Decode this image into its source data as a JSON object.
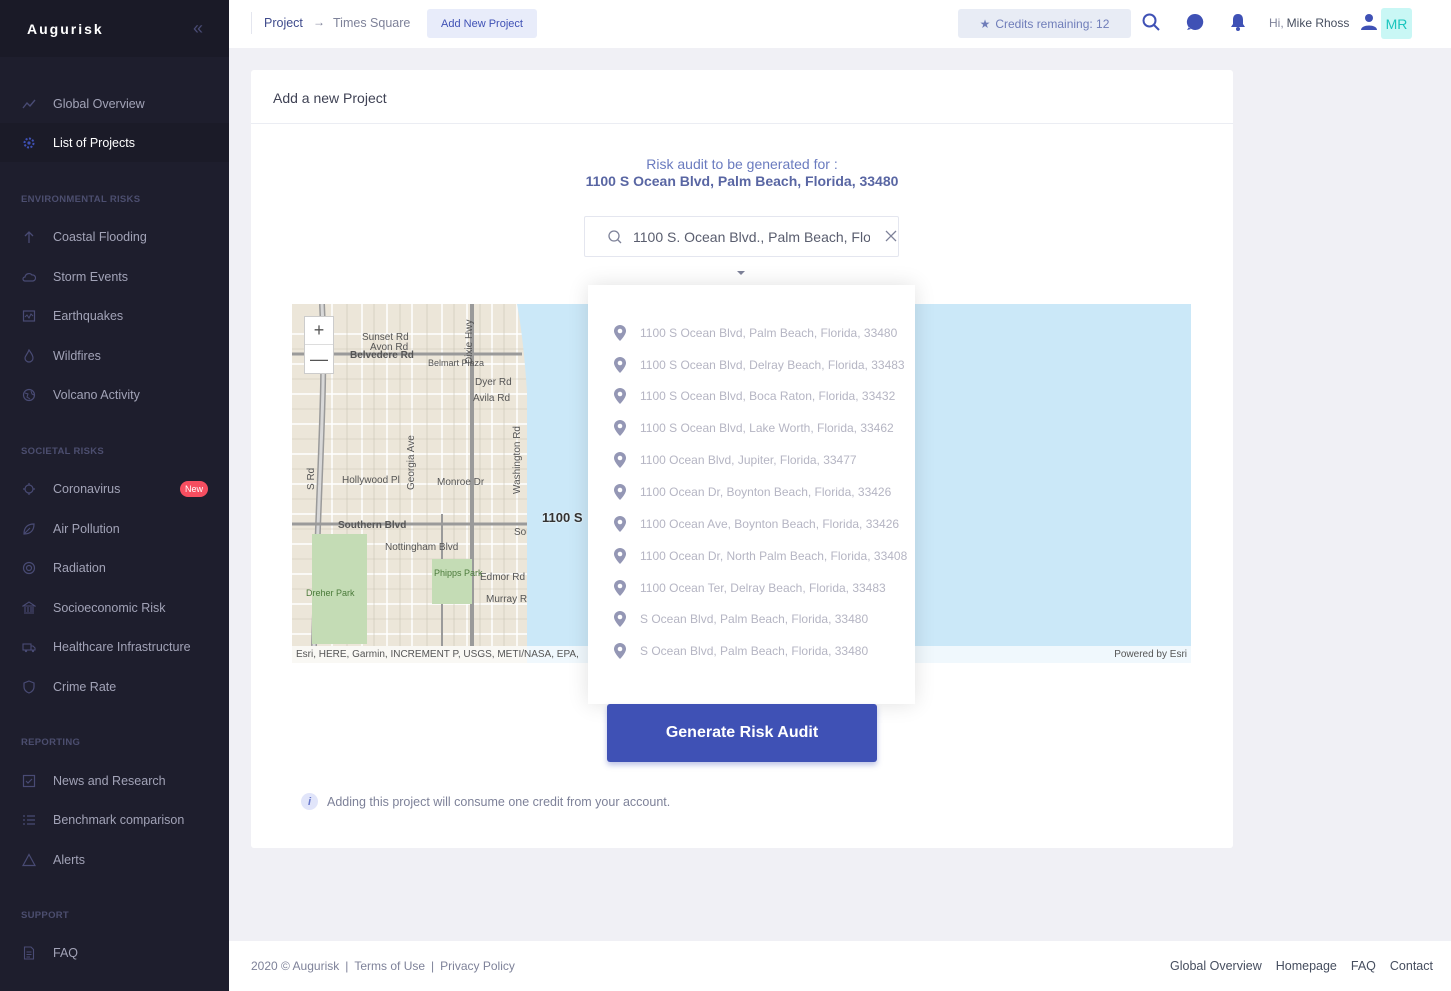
{
  "sidebar": {
    "brand": "Augurisk",
    "items": [
      {
        "label": "Global Overview",
        "icon": "chart-line-icon"
      },
      {
        "label": "List of Projects",
        "icon": "gear-icon",
        "active": true
      }
    ],
    "sections": [
      {
        "title": "ENVIRONMENTAL RISKS",
        "items": [
          {
            "label": "Coastal Flooding",
            "icon": "arrow-up-icon"
          },
          {
            "label": "Storm Events",
            "icon": "cloud-icon"
          },
          {
            "label": "Earthquakes",
            "icon": "seismic-icon"
          },
          {
            "label": "Wildfires",
            "icon": "fire-icon"
          },
          {
            "label": "Volcano Activity",
            "icon": "globe-icon"
          }
        ]
      },
      {
        "title": "SOCIETAL RISKS",
        "items": [
          {
            "label": "Coronavirus",
            "icon": "virus-icon",
            "badge": "New"
          },
          {
            "label": "Air Pollution",
            "icon": "leaf-icon"
          },
          {
            "label": "Radiation",
            "icon": "radiation-icon"
          },
          {
            "label": "Socioeconomic Risk",
            "icon": "bank-icon"
          },
          {
            "label": "Healthcare Infrastructure",
            "icon": "ambulance-icon"
          },
          {
            "label": "Crime Rate",
            "icon": "shield-icon"
          }
        ]
      },
      {
        "title": "REPORTING",
        "items": [
          {
            "label": "News and Research",
            "icon": "checkbox-icon"
          },
          {
            "label": "Benchmark comparison",
            "icon": "list-icon"
          },
          {
            "label": "Alerts",
            "icon": "warning-icon"
          }
        ]
      },
      {
        "title": "SUPPORT",
        "items": [
          {
            "label": "FAQ",
            "icon": "document-icon"
          }
        ]
      }
    ]
  },
  "header": {
    "breadcrumb": {
      "project": "Project",
      "current": "Times Square"
    },
    "add_button": "Add New Project",
    "credits": "Credits remaining: 12",
    "greeting": "Hi,",
    "user_name": "Mike Rhoss",
    "avatar_initials": "MR"
  },
  "card": {
    "title": "Add a new Project",
    "audit_label": "Risk audit to be generated for :",
    "audit_address": "1100 S Ocean Blvd, Palm Beach, Florida, 33480",
    "search_value": "1100 S. Ocean Blvd., Palm Beach, Flo",
    "suggestions": [
      "1100 S Ocean Blvd, Palm Beach, Florida, 33480",
      "1100 S Ocean Blvd, Delray Beach, Florida, 33483",
      "1100 S Ocean Blvd, Boca Raton, Florida, 33432",
      "1100 S Ocean Blvd, Lake Worth, Florida, 33462",
      "1100 Ocean Blvd, Jupiter, Florida, 33477",
      "1100 Ocean Dr, Boynton Beach, Florida, 33426",
      "1100 Ocean Ave, Boynton Beach, Florida, 33426",
      "1100 Ocean Dr, North Palm Beach, Florida, 33408",
      "1100 Ocean Ter, Delray Beach, Florida, 33483",
      "S Ocean Blvd, Palm Beach, Florida, 33480",
      "S Ocean Blvd, Palm Beach, Florida, 33480"
    ],
    "map": {
      "attribution": "Esri, HERE, Garmin, INCREMENT P, USGS, METI/NASA, EPA,",
      "powered_by": "Powered by Esri",
      "marker_label": "1100 S",
      "labels": [
        "Sunset Rd",
        "Avon Rd",
        "Belvedere Rd",
        "Belmart Plaza",
        "Dyer Rd",
        "Avila Rd",
        "Hollywood Pl",
        "Monroe Dr",
        "Southern Blvd",
        "Southern Blvd",
        "Nottingham Blvd",
        "Edmor Rd",
        "Murray Rd",
        "Phipps Park",
        "Dreher Park",
        "Georgia Ave",
        "Washington Rd",
        "Dixie Hwy",
        "S Rd"
      ],
      "zoom_in": "+",
      "zoom_out": "—"
    },
    "generate_button": "Generate Risk Audit",
    "info_text": "Adding this project will consume one credit from your account."
  },
  "footer": {
    "copyright": "2020 © Augurisk",
    "terms": "Terms of Use",
    "privacy": "Privacy Policy",
    "links": [
      "Global Overview",
      "Homepage",
      "FAQ",
      "Contact"
    ]
  },
  "colors": {
    "sidebar_bg": "#1e1e2d",
    "primary": "#3f51b5",
    "badge": "#f64e60",
    "avatar_bg": "#c9f7f5",
    "avatar_fg": "#1bc5bd"
  }
}
